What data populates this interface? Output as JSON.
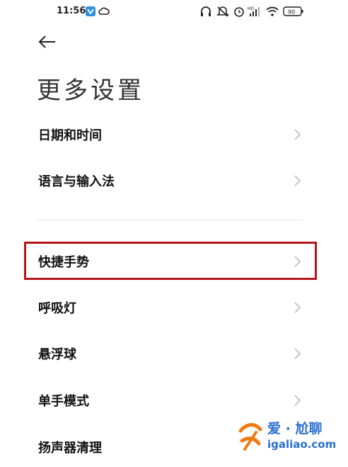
{
  "status_bar": {
    "time": "11:56",
    "battery": "90",
    "icons": [
      "notification-app-icon",
      "cloud-icon",
      "headphones-icon",
      "alarm-off-icon",
      "alarm-icon",
      "hd-signal-icon",
      "wifi-icon",
      "battery-icon"
    ]
  },
  "header": {
    "back_icon": "arrow-left-icon",
    "title": "更多设置"
  },
  "settings": {
    "items": [
      {
        "label": "日期和时间"
      },
      {
        "label": "语言与输入法"
      },
      {
        "label": "快捷手势"
      },
      {
        "label": "呼吸灯"
      },
      {
        "label": "悬浮球"
      },
      {
        "label": "单手模式"
      },
      {
        "label": "扬声器清理"
      }
    ],
    "highlighted_index": 2,
    "highlight_color": "#b5161b"
  },
  "watermark": {
    "line1": "爱 · 尬聊",
    "line2": "igaliao.com",
    "color": "#2a6fd0"
  }
}
